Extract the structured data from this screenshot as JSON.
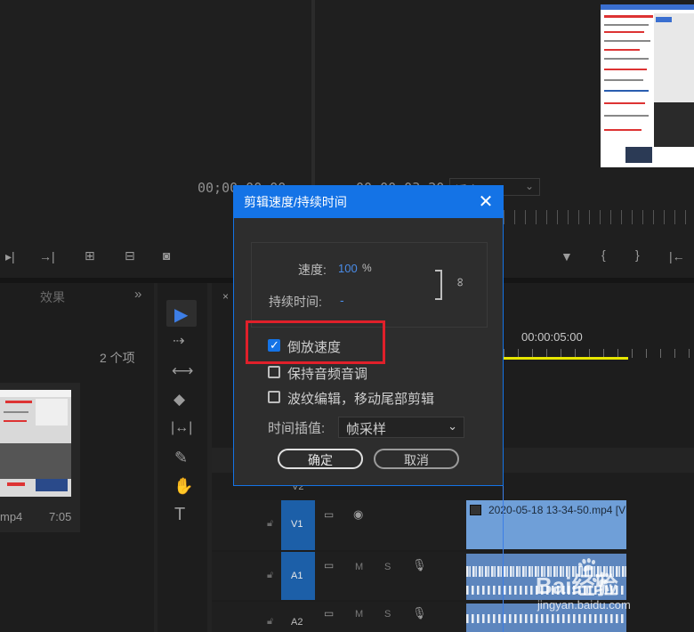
{
  "program_monitor": {
    "timecode_left": "00;00;00;00",
    "timecode_right": "00;00;03;20",
    "fit_label": "适合"
  },
  "project_panel": {
    "tab_effects": "效果",
    "item_count": "2 个项",
    "clip_name": "mp4",
    "clip_duration": "7:05"
  },
  "timeline": {
    "ruler_time": "00:00:05:00",
    "tracks": [
      {
        "name": "V2",
        "kind": "video"
      },
      {
        "name": "V1",
        "kind": "video"
      },
      {
        "name": "A1",
        "kind": "audio"
      },
      {
        "name": "A2",
        "kind": "audio"
      }
    ],
    "clip_v1_label": "2020-05-18 13-34-50.mp4 [V",
    "audio_m": "M",
    "audio_s": "S"
  },
  "dialog": {
    "title": "剪辑速度/持续时间",
    "speed_label": "速度:",
    "speed_value": "100",
    "speed_unit": "%",
    "duration_label": "持续时间:",
    "duration_value": "-",
    "checkboxes": [
      {
        "label": "倒放速度",
        "checked": true
      },
      {
        "label": "保持音频音调",
        "checked": false
      },
      {
        "label": "波纹编辑，移动尾部剪辑",
        "checked": false
      }
    ],
    "interp_label": "时间插值:",
    "interp_value": "帧采样",
    "ok_label": "确定",
    "cancel_label": "取消"
  },
  "watermark": {
    "text": "Bai经验",
    "url": "jingyan.baidu.com"
  },
  "colors": {
    "accent": "#1473e6",
    "highlight_box": "#e0202a",
    "v1_clip": "#6f9fd8",
    "playhead_bar": "#e6e600"
  }
}
